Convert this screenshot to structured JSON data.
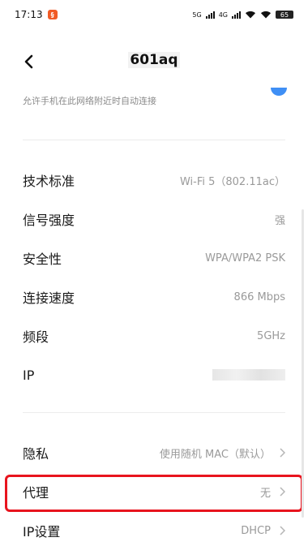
{
  "status_bar": {
    "time": "17:13",
    "notification_icon": "app-notification-icon",
    "sim1": "5G",
    "sim2": "4G",
    "battery": "65"
  },
  "header": {
    "back_icon": "chevron-left-icon",
    "title": "601aq"
  },
  "auto_connect": {
    "hint": "允许手机在此网络附近时自动连接"
  },
  "details": [
    {
      "label": "技术标准",
      "value": "Wi-Fi 5（802.11ac）"
    },
    {
      "label": "信号强度",
      "value": "强"
    },
    {
      "label": "安全性",
      "value": "WPA/WPA2 PSK"
    },
    {
      "label": "连接速度",
      "value": "866 Mbps"
    },
    {
      "label": "频段",
      "value": "5GHz"
    },
    {
      "label": "IP",
      "value": ""
    }
  ],
  "settings": [
    {
      "label": "隐私",
      "value": "使用随机 MAC（默认）"
    },
    {
      "label": "代理",
      "value": "无"
    },
    {
      "label": "IP设置",
      "value": "DHCP"
    }
  ],
  "colors": {
    "highlight": "#e8141e",
    "accent": "#3f8ff5",
    "secondary_text": "#9a9a9a"
  }
}
